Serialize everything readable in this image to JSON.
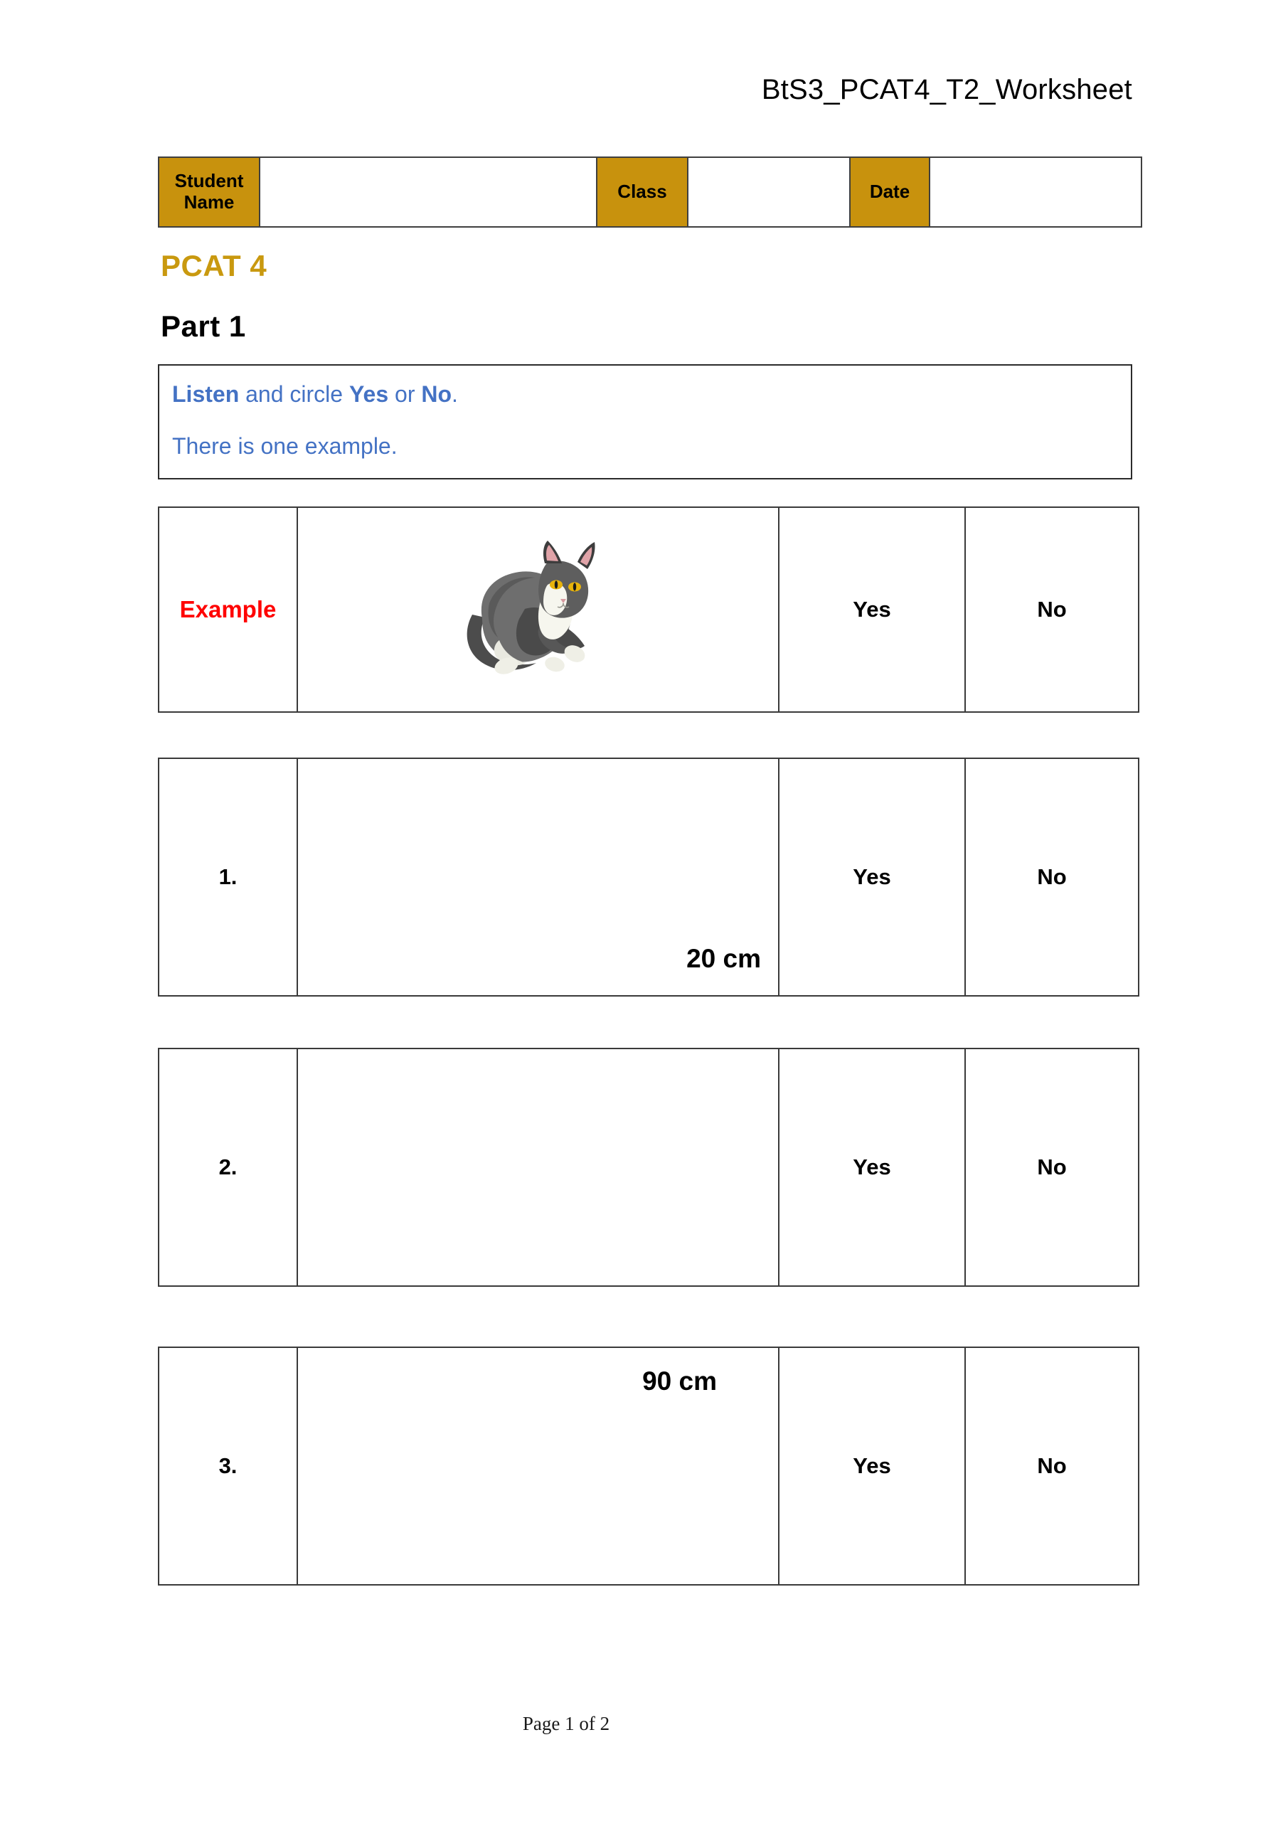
{
  "header": {
    "doc_title": "BtS3_PCAT4_T2_Worksheet"
  },
  "info_table": {
    "student_name_label": "Student Name",
    "student_name_value": "",
    "class_label": "Class",
    "class_value": "",
    "date_label": "Date",
    "date_value": "",
    "label_bg_color": "#C8920D"
  },
  "headings": {
    "pcat": "PCAT 4",
    "pcat_color": "#C9990F",
    "part": "Part 1"
  },
  "instructions": {
    "line1_pre": "Listen",
    "line1_mid": " and circle ",
    "line1_yes": "Yes",
    "line1_or": " or ",
    "line1_no": "No",
    "line1_end": ".",
    "line2": "There is one example.",
    "text_color": "#4472C4"
  },
  "questions": [
    {
      "number": "Example",
      "number_color": "#FF0000",
      "is_example": true,
      "image": "cat-illustration",
      "measure": "",
      "yes": "Yes",
      "no": "No"
    },
    {
      "number": "1.",
      "is_example": false,
      "image": "",
      "measure": "20 cm",
      "yes": "Yes",
      "no": "No"
    },
    {
      "number": "2.",
      "is_example": false,
      "image": "",
      "measure": "",
      "yes": "Yes",
      "no": "No"
    },
    {
      "number": "3.",
      "is_example": false,
      "image": "",
      "measure": "90 cm",
      "yes": "Yes",
      "no": "No"
    }
  ],
  "footer": {
    "page_label": "Page 1 of 2"
  }
}
